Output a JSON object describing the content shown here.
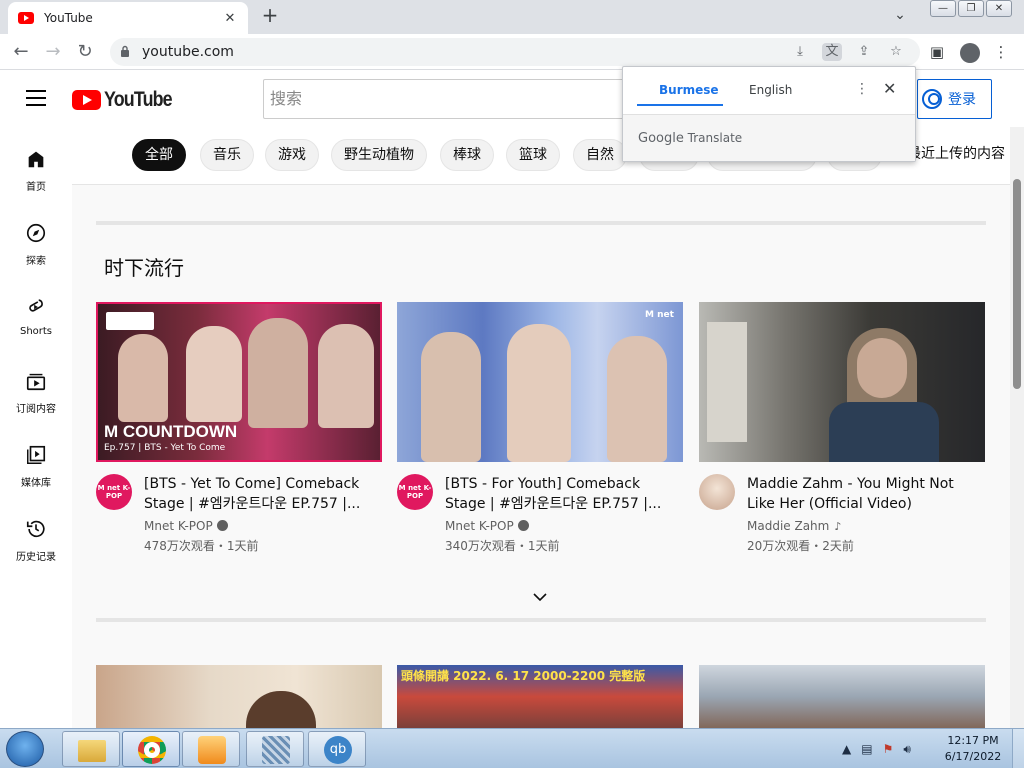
{
  "browser": {
    "tab_title": "YouTube",
    "tab_close": "✕",
    "new_tab": "+",
    "url": "youtube.com"
  },
  "yt": {
    "logo_text": "YouTube",
    "search_placeholder": "搜索",
    "signin_label": "登录",
    "brand_red": "#ff0000",
    "link_blue": "#065fd4"
  },
  "chips": [
    "全部",
    "音乐",
    "游戏",
    "野生动植物",
    "棒球",
    "篮球",
    "自然",
    "最近上传的内容"
  ],
  "guide": [
    {
      "label": "首页",
      "icon": "home-icon"
    },
    {
      "label": "探索",
      "icon": "compass-icon"
    },
    {
      "label": "Shorts",
      "icon": "shorts-icon"
    },
    {
      "label": "订阅内容",
      "icon": "subscriptions-icon"
    },
    {
      "label": "媒体库",
      "icon": "library-icon"
    },
    {
      "label": "历史记录",
      "icon": "history-icon"
    }
  ],
  "section": {
    "title": "时下流行"
  },
  "videos": [
    {
      "title": "[BTS - Yet To Come] Comeback Stage | #엠카운트다운 EP.757 |...",
      "channel": "Mnet K-POP",
      "stats": "478万次观看・1天前",
      "thumb_text_1": "M COUNTDOWN",
      "thumb_text_2": "Ep.757 | BTS - Yet To Come",
      "avatar_text": "M net K-POP"
    },
    {
      "title": "[BTS - For Youth] Comeback Stage | #엠카운트다운 EP.757 |...",
      "channel": "Mnet K-POP",
      "stats": "340万次观看・1天前",
      "thumb_text_1": "M net",
      "avatar_text": "M net K-POP"
    },
    {
      "title": "Maddie Zahm - You Might Not Like Her (Official Video)",
      "channel": "Maddie Zahm",
      "stats": "20万次观看・2天前"
    }
  ],
  "row2": [
    {
      "thumb_text": ""
    },
    {
      "thumb_text": "頭條開講  2022. 6. 17  2000-2200  完整版"
    },
    {
      "thumb_text": ""
    }
  ],
  "translate_popup": {
    "tab_source": "Burmese",
    "tab_target": "English",
    "brand_google": "Google",
    "brand_translate": "Translate"
  },
  "taskbar": {
    "time": "12:17 PM",
    "date": "6/17/2022"
  }
}
